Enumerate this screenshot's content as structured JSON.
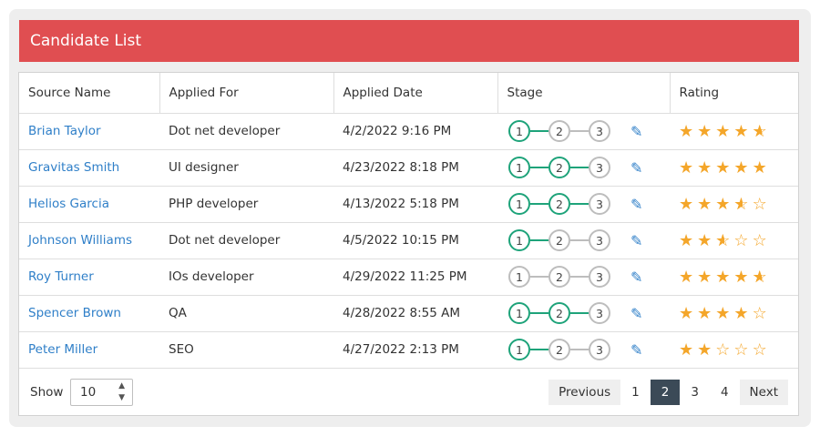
{
  "card": {
    "title": "Candidate List"
  },
  "table": {
    "headers": [
      "Source Name",
      "Applied For",
      "Applied Date",
      "Stage",
      "Rating"
    ],
    "rows": [
      {
        "name": "Brian Taylor",
        "role": "Dot net developer",
        "date": "4/2/2022 9:16 PM",
        "stage": 1,
        "rating": 4.5
      },
      {
        "name": "Gravitas Smith",
        "role": "UI designer",
        "date": "4/23/2022 8:18 PM",
        "stage": 2,
        "rating": 5
      },
      {
        "name": "Helios Garcia",
        "role": "PHP developer",
        "date": "4/13/2022 5:18 PM",
        "stage": 2,
        "rating": 3.5
      },
      {
        "name": "Johnson Williams",
        "role": "Dot net developer",
        "date": "4/5/2022 10:15 PM",
        "stage": 1,
        "rating": 2.5
      },
      {
        "name": "Roy Turner",
        "role": "IOs developer",
        "date": "4/29/2022 11:25 PM",
        "stage": 0,
        "rating": 4.5
      },
      {
        "name": "Spencer Brown",
        "role": "QA",
        "date": "4/28/2022 8:55 AM",
        "stage": 2,
        "rating": 4
      },
      {
        "name": "Peter Miller",
        "role": "SEO",
        "date": "4/27/2022 2:13 PM",
        "stage": 1,
        "rating": 2
      }
    ],
    "stage_labels": [
      "1",
      "2",
      "3"
    ]
  },
  "footer": {
    "show_label": "Show",
    "page_size": "10",
    "previous_label": "Previous",
    "next_label": "Next",
    "pages": [
      "1",
      "2",
      "3",
      "4"
    ],
    "active_page": "2"
  },
  "colors": {
    "header_bg": "#e04e51",
    "link": "#2f7fc8",
    "stage_active": "#1ea37a",
    "star": "#f4a62a",
    "page_active": "#3b4a57"
  },
  "icons": {
    "edit": "pencil-icon",
    "star": "star-icon",
    "sort": "chevron-updown-icon"
  }
}
